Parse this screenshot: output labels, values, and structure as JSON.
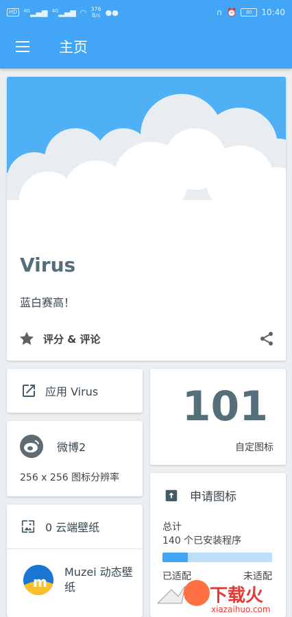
{
  "status_bar": {
    "network_chip": "HD",
    "signal_1": "4G",
    "signal_2": "4G",
    "speed_value": "376",
    "speed_unit": "B/s",
    "time": "10:40",
    "battery_label": "80"
  },
  "appbar": {
    "title": "主页",
    "menu_icon": "hamburger-menu-icon"
  },
  "hero": {
    "title": "Virus",
    "subtitle": "蓝白赛高！",
    "rate_label": "评分 & 评论",
    "rate_icon": "star-icon",
    "share_icon": "share-icon",
    "sky_color": "#4fb0f5"
  },
  "apply": {
    "label": "应用 Virus",
    "icon": "open-in-new-icon"
  },
  "weibo": {
    "name": "微博2",
    "resolution": "256 x 256 图标分辨率",
    "icon": "weibo-icon"
  },
  "wallpaper": {
    "cloud_label": "0 云端壁纸",
    "cloud_icon": "wallpaper-icon",
    "muzei_label": "Muzei 动态壁纸",
    "muzei_icon": "muzei-icon"
  },
  "icon_count": {
    "number": "101",
    "label": "自定图标"
  },
  "request": {
    "title": "申请图标",
    "icon": "request-icon",
    "total_label": "总计",
    "installed": "140 个已安装程序",
    "themed_fraction": 0.23,
    "themed_label": "已适配",
    "unthemed_label": "未适配"
  },
  "watermark": {
    "text": "下载火",
    "url": "xiazaihuo.com"
  },
  "colors": {
    "primary": "#42a5f5",
    "primary_light": "#bbdefb",
    "background": "#eceff1",
    "text_grey": "#546e7a"
  }
}
